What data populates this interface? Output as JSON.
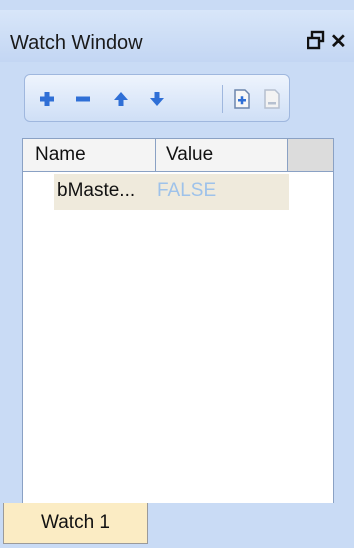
{
  "window": {
    "title": "Watch Window",
    "float_icon": "pin-float-icon",
    "close_icon": "close-icon",
    "float_glyph": "ᗡ",
    "close_glyph": "✕"
  },
  "toolbar": {
    "buttons": [
      {
        "icon": "add-icon",
        "enabled": true
      },
      {
        "icon": "remove-icon",
        "enabled": true
      },
      {
        "icon": "move-up-icon",
        "enabled": true
      },
      {
        "icon": "move-down-icon",
        "enabled": true
      },
      {
        "icon": "add-watch-page-icon",
        "enabled": true
      },
      {
        "icon": "remove-watch-page-icon",
        "enabled": false
      }
    ]
  },
  "grid": {
    "columns": [
      "Name",
      "Value"
    ],
    "rows": [
      {
        "name": "bMaste...",
        "value": "FALSE"
      }
    ]
  },
  "tabs": [
    {
      "label": "Watch 1",
      "selected": true
    }
  ],
  "colors": {
    "accent_blue": "#2f6fd6",
    "value_text": "#9ec2ea",
    "row_highlight": "#efeadc",
    "tab_selected": "#fbecc4"
  }
}
